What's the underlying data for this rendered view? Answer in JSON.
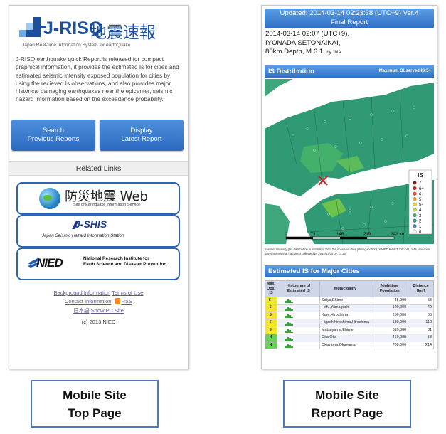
{
  "left": {
    "logo": {
      "name": "J-RISQ",
      "jp": "地震速報",
      "subtitle": "Japan Real-time Information System for earthQuake"
    },
    "intro": "J-RISQ earthquake quick Report is released for compact graphical information, it provides the estimated Is for cities and estimated seismic intensity exposed population for cities by using the recieved Is observations, and also provides major historical damaging earthquakes near the epicenter, seismic hazard information based on the exceedance probability.",
    "buttons": {
      "search": [
        "Search",
        "Previous Reports"
      ],
      "display": [
        "Display",
        "Latest Report"
      ]
    },
    "related_links_title": "Related Links",
    "links": {
      "bousai": {
        "title": "防災地震 Web",
        "sub": "Site of Earthquake Information Service"
      },
      "jshis": {
        "title": "J-SHIS",
        "sub": "Japan Seismic Hazard Information Station"
      },
      "nied": {
        "title": "NIED",
        "sub1": "National Research Institute for",
        "sub2": "Earth Science and Disaster Prevention"
      }
    },
    "footer": {
      "background_info": "Background Information",
      "terms": "Terms of Use",
      "contact": "Contact Information",
      "rss": "RSS",
      "japanese": "日本語",
      "show_pc": "Show PC Site",
      "copyright": "(c) 2013 NIED"
    }
  },
  "right": {
    "header": {
      "line1": "Updated: 2014-03-14 02:23:38 (UTC+9) Ver.4",
      "line2": "Final Report"
    },
    "event": {
      "line1": "2014-03-14 02:07 (UTC+9),",
      "line2": "IYONADA SETONAIKAI,",
      "line3": "80km Depth, M 6.1,",
      "source": "by JMA"
    },
    "is_section": {
      "title": "IS Distribution",
      "max": "Maximum Observed IS:5+"
    },
    "legend": {
      "title": "IS",
      "items": [
        "7",
        "6+",
        "6-",
        "5+",
        "5-",
        "4",
        "3",
        "2",
        "1",
        "0"
      ]
    },
    "scale": {
      "ticks": [
        "0",
        "73",
        "146",
        "219",
        "292"
      ],
      "unit": "km"
    },
    "map_note": "Seismic Intensity (IS) distribution is estimated from the observed data (strong-motion) of NIED K-NET, KiK-net, JMA, and local governments that had been collected by 2014/03/14 07:17:13.",
    "cities_section": {
      "title": "Estimated IS for Major Cities"
    },
    "table": {
      "headers": {
        "max": "Max. Obs. IS",
        "hist": "Histogram of Estimated IS",
        "muni": "Municipality",
        "pop": "Nighttime Population",
        "dist": "Distance [km]"
      },
      "rows": [
        {
          "level": "5+",
          "muni": "Seiyo,Ehime",
          "pop": "45,000",
          "dist": "68"
        },
        {
          "level": "5-",
          "muni": "Hofu,Yamaguchi",
          "pop": "120,000",
          "dist": "49"
        },
        {
          "level": "5-",
          "muni": "Kure,Hiroshima",
          "pop": "250,000",
          "dist": "86"
        },
        {
          "level": "5-",
          "muni": "Higashihiroshima,Hiroshima",
          "pop": "180,000",
          "dist": "112"
        },
        {
          "level": "5-",
          "muni": "Matsuyama,Ehime",
          "pop": "510,000",
          "dist": "81"
        },
        {
          "level": "4",
          "muni": "Oita,Oita",
          "pop": "460,000",
          "dist": "58"
        },
        {
          "level": "4",
          "muni": "Okayama,Okayama",
          "pop": "700,000",
          "dist": "214"
        }
      ]
    }
  },
  "captions": {
    "left": [
      "Mobile Site",
      "Top Page"
    ],
    "right": [
      "Mobile Site",
      "Report Page"
    ]
  },
  "colors": {
    "brand": "#1c4f9c",
    "button": "#2d6ac0",
    "sea": "#ffffff",
    "land": "#2f9a73",
    "epicenter": "#c0282d"
  }
}
